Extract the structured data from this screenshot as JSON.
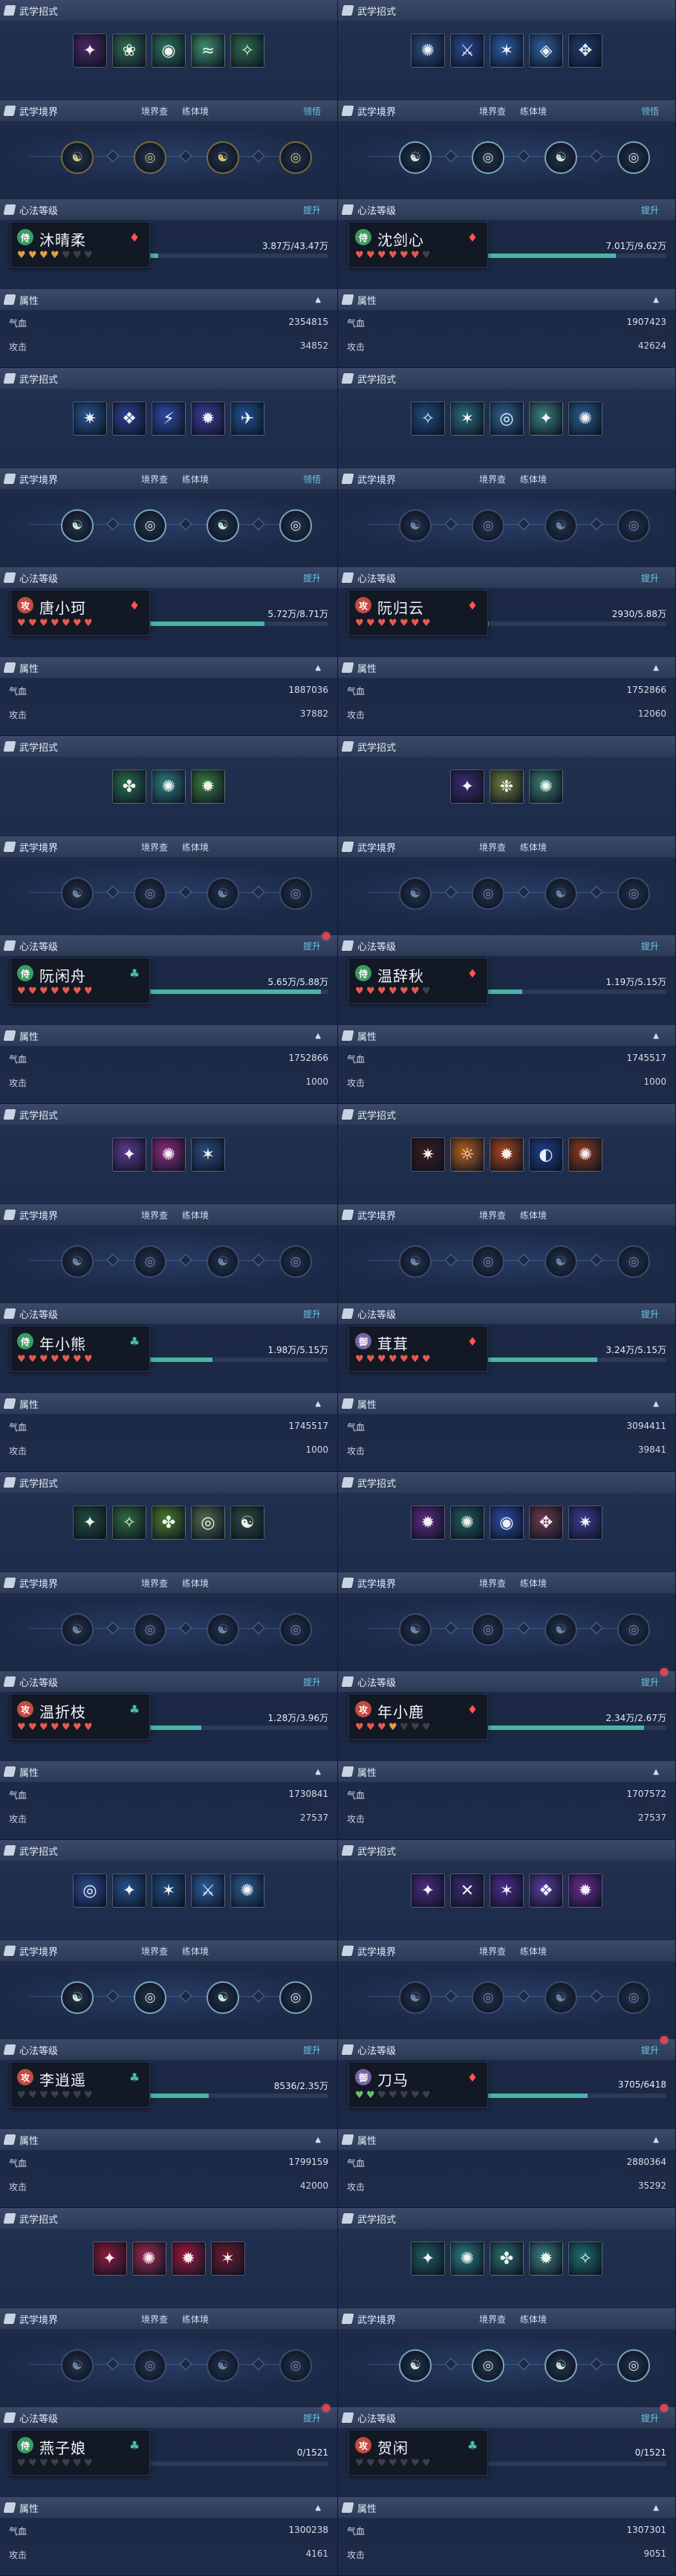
{
  "labels": {
    "skills": "武学招式",
    "realm": "武学境界",
    "realm_col_a": "境界查",
    "realm_col_b": "练体境",
    "realm_link": "领悟",
    "heart_level": "心法等级",
    "upgrade": "提升",
    "attrs": "属性",
    "hp": "气血",
    "atk": "攻击"
  },
  "colors": {
    "accent_link": "#6cc7e6",
    "progress_fill": "#48b7a4",
    "heart_red": "#e65a4f",
    "heart_orange": "#e2a044",
    "heart_green": "#6cc06a",
    "alert_dot": "#e0444d"
  },
  "cards": [
    {
      "name": "沐晴柔",
      "badge": "green-badge",
      "faction": "red-faction-icon",
      "progress": "3.87万/43.47万",
      "progress_fraction": 0.09,
      "hearts": [
        "o",
        "o",
        "o",
        "o",
        "e",
        "e",
        "e"
      ],
      "realm_link": true,
      "upgrade_dot": false,
      "hp": "2354815",
      "atk": "34852",
      "skill_colors": [
        "#4a2660",
        "#2e6a4e",
        "#2a7058",
        "#3d8a6a",
        "#2c6a4a"
      ],
      "skill_icons": [
        "✦",
        "❀",
        "◉",
        "≈",
        "✧"
      ],
      "realm_style": "gold"
    },
    {
      "name": "沈剑心",
      "badge": "green-badge",
      "faction": "red-faction-icon",
      "progress": "7.01万/9.62万",
      "progress_fraction": 0.73,
      "hearts": [
        "r",
        "r",
        "r",
        "r",
        "r",
        "r",
        "e"
      ],
      "realm_link": true,
      "upgrade_dot": false,
      "hp": "1907423",
      "atk": "42624",
      "skill_colors": [
        "#2b4c7a",
        "#27468a",
        "#2a5ba0",
        "#2f5e9a",
        "#1f3b6a"
      ],
      "skill_icons": [
        "✺",
        "⚔",
        "✶",
        "◈",
        "✥"
      ],
      "realm_style": "lit"
    },
    {
      "name": "唐小珂",
      "badge": "red-badge",
      "faction": "red-faction-icon",
      "progress": "5.72万/8.71万",
      "progress_fraction": 0.66,
      "hearts": [
        "r",
        "r",
        "r",
        "r",
        "r",
        "r",
        "r"
      ],
      "realm_link": true,
      "upgrade_dot": false,
      "hp": "1887036",
      "atk": "37882",
      "skill_colors": [
        "#28528a",
        "#2a3f8a",
        "#2d4aa0",
        "#3a3c94",
        "#1f4f8e"
      ],
      "skill_icons": [
        "✷",
        "❖",
        "⚡",
        "✹",
        "✈"
      ],
      "realm_style": "lit"
    },
    {
      "name": "阮归云",
      "badge": "red-badge",
      "faction": "red-faction-icon",
      "progress": "2930/5.88万",
      "progress_fraction": 0.05,
      "hearts": [
        "r",
        "r",
        "r",
        "r",
        "r",
        "r",
        "r"
      ],
      "realm_link": false,
      "upgrade_dot": false,
      "hp": "1752866",
      "atk": "12060",
      "skill_colors": [
        "#1f4a78",
        "#2a6a78",
        "#2d5f8a",
        "#3a7e7a",
        "#2a5a88"
      ],
      "skill_icons": [
        "✧",
        "✶",
        "◎",
        "✦",
        "✺"
      ],
      "realm_style": "plain"
    },
    {
      "name": "阮闲舟",
      "badge": "green-badge",
      "faction": "green-faction-icon",
      "progress": "5.65万/5.88万",
      "progress_fraction": 0.96,
      "hearts": [
        "r",
        "r",
        "r",
        "r",
        "r",
        "r",
        "r"
      ],
      "realm_link": false,
      "upgrade_dot": true,
      "hp": "1752866",
      "atk": "1000",
      "skill_colors": [
        "#2a6a4a",
        "#2c7a7a",
        "#3a7a3a"
      ],
      "skill_icons": [
        "✤",
        "✺",
        "✹"
      ],
      "realm_style": "plain"
    },
    {
      "name": "温辞秋",
      "badge": "green-badge",
      "faction": "red-faction-icon",
      "progress": "1.19万/5.15万",
      "progress_fraction": 0.23,
      "hearts": [
        "r",
        "r",
        "r",
        "r",
        "r",
        "r",
        "e"
      ],
      "realm_link": false,
      "upgrade_dot": false,
      "hp": "1745517",
      "atk": "1000",
      "skill_colors": [
        "#3a2a6a",
        "#6a7a3a",
        "#3a7a6a"
      ],
      "skill_icons": [
        "✦",
        "❉",
        "✺"
      ],
      "realm_style": "plain"
    },
    {
      "name": "年小熊",
      "badge": "green-badge",
      "faction": "green-faction-icon",
      "progress": "1.98万/5.15万",
      "progress_fraction": 0.38,
      "hearts": [
        "r",
        "r",
        "r",
        "r",
        "r",
        "r",
        "r"
      ],
      "realm_link": false,
      "upgrade_dot": false,
      "hp": "1745517",
      "atk": "1000",
      "skill_colors": [
        "#5a3a8a",
        "#8a2a7a",
        "#2a4a7a"
      ],
      "skill_icons": [
        "✦",
        "✺",
        "✶"
      ],
      "realm_style": "plain"
    },
    {
      "name": "茸茸",
      "badge": "purple-badge",
      "faction": "red-faction-icon",
      "progress": "3.24万/5.15万",
      "progress_fraction": 0.63,
      "hearts": [
        "r",
        "r",
        "r",
        "r",
        "r",
        "r",
        "r"
      ],
      "realm_link": false,
      "upgrade_dot": false,
      "hp": "3094411",
      "atk": "39841",
      "skill_colors": [
        "#3a1a1a",
        "#b0601a",
        "#a8441a",
        "#1e3c86",
        "#8a3a1a"
      ],
      "skill_icons": [
        "✷",
        "☼",
        "✹",
        "◐",
        "✺"
      ],
      "realm_style": "plain"
    },
    {
      "name": "温折枝",
      "badge": "red-badge",
      "faction": "green-faction-icon",
      "progress": "1.28万/3.96万",
      "progress_fraction": 0.32,
      "hearts": [
        "r",
        "r",
        "r",
        "r",
        "r",
        "r",
        "r"
      ],
      "realm_link": false,
      "upgrade_dot": false,
      "hp": "1730841",
      "atk": "27537",
      "skill_colors": [
        "#1f4a3a",
        "#2e6a3a",
        "#4a7a2a",
        "#4f6a4a",
        "#2a4a3a"
      ],
      "skill_icons": [
        "✦",
        "✧",
        "✤",
        "◎",
        "☯"
      ],
      "realm_style": "plain"
    },
    {
      "name": "年小鹿",
      "badge": "red-badge",
      "faction": "red-faction-icon",
      "progress": "2.34万/2.67万",
      "progress_fraction": 0.88,
      "hearts": [
        "r",
        "r",
        "r",
        "o",
        "e",
        "e",
        "e"
      ],
      "realm_link": false,
      "upgrade_dot": true,
      "hp": "1707572",
      "atk": "27537",
      "skill_colors": [
        "#5a2a7a",
        "#1f5a5a",
        "#2a4aa0",
        "#6a3a4a",
        "#3a3a8a"
      ],
      "skill_icons": [
        "✹",
        "✺",
        "◉",
        "✥",
        "✷"
      ],
      "realm_style": "plain"
    },
    {
      "name": "李逍遥",
      "badge": "red-badge",
      "faction": "green-faction-icon",
      "progress": "8536/2.35万",
      "progress_fraction": 0.36,
      "hearts": [
        "e",
        "e",
        "e",
        "e",
        "e",
        "e",
        "e"
      ],
      "realm_link": false,
      "upgrade_dot": false,
      "hp": "1799159",
      "atk": "42000",
      "skill_colors": [
        "#2a4a8a",
        "#24508a",
        "#1f4a7a",
        "#2a5a9a",
        "#2a5a8a"
      ],
      "skill_icons": [
        "◎",
        "✦",
        "✶",
        "⚔",
        "✺"
      ],
      "realm_style": "lit"
    },
    {
      "name": "刀马",
      "badge": "purple-badge",
      "faction": "red-faction-icon",
      "progress": "3705/6418",
      "progress_fraction": 0.58,
      "hearts": [
        "g",
        "g",
        "e",
        "e",
        "e",
        "e",
        "e"
      ],
      "realm_link": false,
      "upgrade_dot": true,
      "hp": "2880364",
      "atk": "35292",
      "skill_colors": [
        "#4a2a7a",
        "#3a2a6a",
        "#4a2a8a",
        "#5a3a9a",
        "#6a2a8a"
      ],
      "skill_icons": [
        "✦",
        "✕",
        "✶",
        "❖",
        "✹"
      ],
      "realm_style": "plain"
    },
    {
      "name": "燕子娘",
      "badge": "green-badge",
      "faction": "green-faction-icon",
      "progress": "0/1521",
      "progress_fraction": 0.0,
      "hearts": [
        "e",
        "e",
        "e",
        "e",
        "e",
        "e",
        "e"
      ],
      "realm_link": false,
      "upgrade_dot": true,
      "hp": "1300238",
      "atk": "4161",
      "skill_colors": [
        "#8a1a3a",
        "#9a2a4a",
        "#a0183a",
        "#6a1a2a"
      ],
      "skill_icons": [
        "✦",
        "✺",
        "✹",
        "✶"
      ],
      "realm_style": "plain"
    },
    {
      "name": "贺闲",
      "badge": "red-badge",
      "faction": "green-faction-icon",
      "progress": "0/1521",
      "progress_fraction": 0.0,
      "hearts": [
        "e",
        "e",
        "e",
        "e",
        "e",
        "e",
        "e"
      ],
      "realm_link": false,
      "upgrade_dot": true,
      "hp": "1307301",
      "atk": "9051",
      "skill_colors": [
        "#1f5a5a",
        "#2a7a7a",
        "#2a6a6a",
        "#3a7a7a",
        "#1f6a6a"
      ],
      "skill_icons": [
        "✦",
        "✺",
        "✤",
        "✹",
        "✧"
      ],
      "realm_style": "lit"
    }
  ]
}
